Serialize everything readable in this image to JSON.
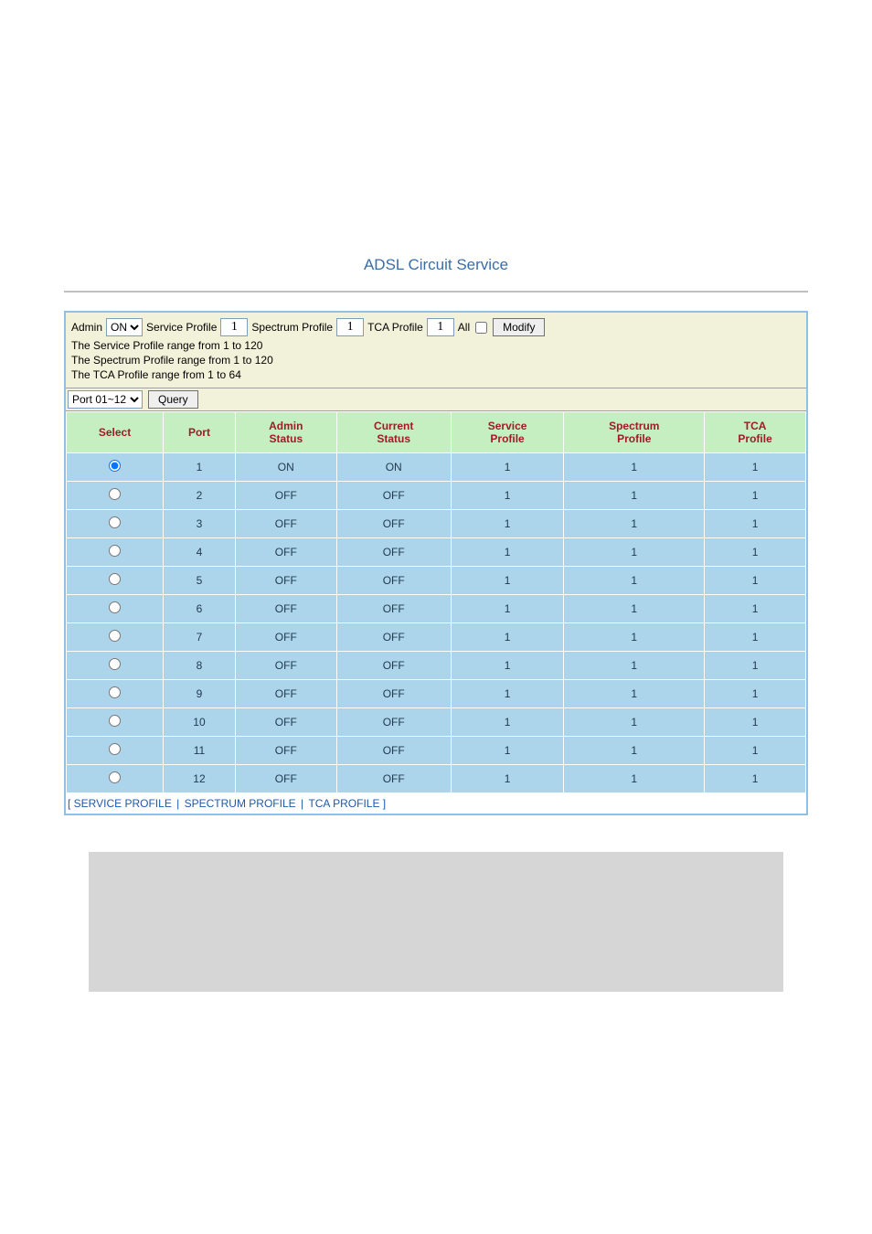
{
  "title": "ADSL Circuit Service",
  "controls": {
    "admin_label": "Admin",
    "admin_value": "ON",
    "service_profile_label": "Service Profile",
    "service_profile_value": "1",
    "spectrum_profile_label": "Spectrum Profile",
    "spectrum_profile_value": "1",
    "tca_profile_label": "TCA Profile",
    "tca_profile_value": "1",
    "all_label": "All",
    "modify_label": "Modify",
    "hint_service": "The Service Profile range from 1 to 120",
    "hint_spectrum": "The Spectrum Profile range from 1 to 120",
    "hint_tca": "The TCA Profile range from 1 to 64",
    "port_range_value": "Port 01~12",
    "query_label": "Query"
  },
  "table": {
    "headers": {
      "select": "Select",
      "port": "Port",
      "admin_status": "Admin\nStatus",
      "current_status": "Current\nStatus",
      "service_profile": "Service\nProfile",
      "spectrum_profile": "Spectrum\nProfile",
      "tca_profile": "TCA\nProfile"
    },
    "rows": [
      {
        "selected": true,
        "port": "1",
        "admin": "ON",
        "current": "ON",
        "svc": "1",
        "spec": "1",
        "tca": "1"
      },
      {
        "selected": false,
        "port": "2",
        "admin": "OFF",
        "current": "OFF",
        "svc": "1",
        "spec": "1",
        "tca": "1"
      },
      {
        "selected": false,
        "port": "3",
        "admin": "OFF",
        "current": "OFF",
        "svc": "1",
        "spec": "1",
        "tca": "1"
      },
      {
        "selected": false,
        "port": "4",
        "admin": "OFF",
        "current": "OFF",
        "svc": "1",
        "spec": "1",
        "tca": "1"
      },
      {
        "selected": false,
        "port": "5",
        "admin": "OFF",
        "current": "OFF",
        "svc": "1",
        "spec": "1",
        "tca": "1"
      },
      {
        "selected": false,
        "port": "6",
        "admin": "OFF",
        "current": "OFF",
        "svc": "1",
        "spec": "1",
        "tca": "1"
      },
      {
        "selected": false,
        "port": "7",
        "admin": "OFF",
        "current": "OFF",
        "svc": "1",
        "spec": "1",
        "tca": "1"
      },
      {
        "selected": false,
        "port": "8",
        "admin": "OFF",
        "current": "OFF",
        "svc": "1",
        "spec": "1",
        "tca": "1"
      },
      {
        "selected": false,
        "port": "9",
        "admin": "OFF",
        "current": "OFF",
        "svc": "1",
        "spec": "1",
        "tca": "1"
      },
      {
        "selected": false,
        "port": "10",
        "admin": "OFF",
        "current": "OFF",
        "svc": "1",
        "spec": "1",
        "tca": "1"
      },
      {
        "selected": false,
        "port": "11",
        "admin": "OFF",
        "current": "OFF",
        "svc": "1",
        "spec": "1",
        "tca": "1"
      },
      {
        "selected": false,
        "port": "12",
        "admin": "OFF",
        "current": "OFF",
        "svc": "1",
        "spec": "1",
        "tca": "1"
      }
    ]
  },
  "links": {
    "service_profile": "SERVICE PROFILE",
    "spectrum_profile": "SPECTRUM PROFILE",
    "tca_profile": "TCA PROFILE"
  }
}
